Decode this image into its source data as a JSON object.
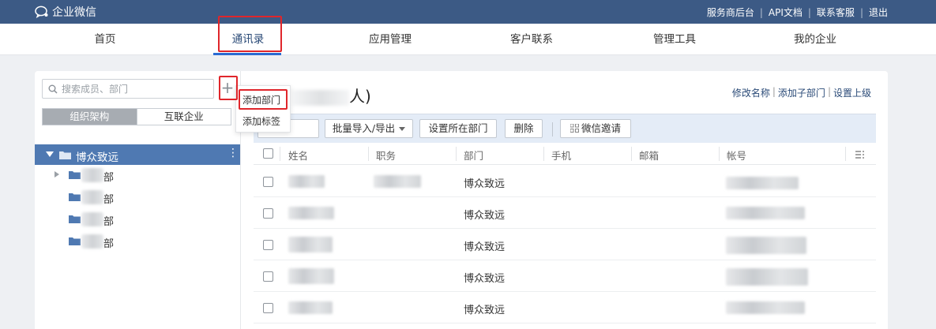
{
  "topbar": {
    "logo_text": "企业微信",
    "links": [
      "服务商后台",
      "API文档",
      "联系客服",
      "退出"
    ],
    "bg_color": "#3c5a85"
  },
  "nav": {
    "items": [
      "首页",
      "通讯录",
      "应用管理",
      "客户联系",
      "管理工具",
      "我的企业"
    ],
    "active": "通讯录"
  },
  "left": {
    "search_placeholder": "搜索成员、部门",
    "plus_label": "+",
    "tabs": [
      "组织架构",
      "互联企业"
    ],
    "root_label": "博众致远",
    "root_more": "⋮",
    "depts": [
      "部",
      "部",
      "部",
      "部"
    ]
  },
  "dropdown": {
    "items": [
      "添加部门",
      "添加标签"
    ]
  },
  "main": {
    "title_prefix": "",
    "title_suffix": "人)",
    "links": [
      "修改名称",
      "添加子部门",
      "设置上级"
    ],
    "toolbar": {
      "import_export": "批量导入/导出",
      "set_dept": "设置所在部门",
      "delete": "删除",
      "wechat_invite": "微信邀请"
    },
    "columns": [
      "姓名",
      "职务",
      "部门",
      "手机",
      "邮箱",
      "帐号"
    ],
    "rows": [
      {
        "dept": "博众致远"
      },
      {
        "dept": "博众致远"
      },
      {
        "dept": "博众致远"
      },
      {
        "dept": "博众致远"
      },
      {
        "dept": "博众致远"
      }
    ]
  }
}
